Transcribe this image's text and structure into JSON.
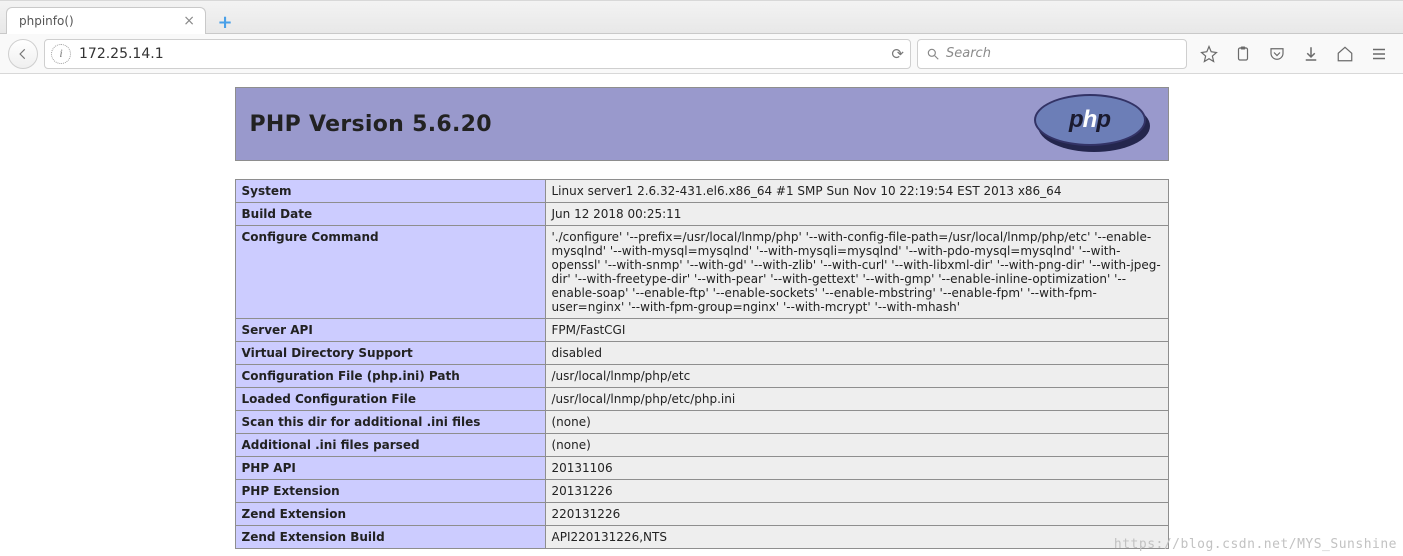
{
  "browser": {
    "tab_title": "phpinfo()",
    "url": "172.25.14.1",
    "search_placeholder": "Search"
  },
  "page": {
    "header_title": "PHP Version 5.6.20",
    "logo_text_a": "p",
    "logo_text_b": "h",
    "logo_text_c": "p",
    "rows": [
      {
        "k": "System",
        "v": "Linux server1 2.6.32-431.el6.x86_64 #1 SMP Sun Nov 10 22:19:54 EST 2013 x86_64"
      },
      {
        "k": "Build Date",
        "v": "Jun 12 2018 00:25:11"
      },
      {
        "k": "Configure Command",
        "v": "'./configure' '--prefix=/usr/local/lnmp/php' '--with-config-file-path=/usr/local/lnmp/php/etc' '--enable-mysqlnd' '--with-mysql=mysqlnd' '--with-mysqli=mysqlnd' '--with-pdo-mysql=mysqlnd' '--with-openssl' '--with-snmp' '--with-gd' '--with-zlib' '--with-curl' '--with-libxml-dir' '--with-png-dir' '--with-jpeg-dir' '--with-freetype-dir' '--with-pear' '--with-gettext' '--with-gmp' '--enable-inline-optimization' '--enable-soap' '--enable-ftp' '--enable-sockets' '--enable-mbstring' '--enable-fpm' '--with-fpm-user=nginx' '--with-fpm-group=nginx' '--with-mcrypt' '--with-mhash'"
      },
      {
        "k": "Server API",
        "v": "FPM/FastCGI"
      },
      {
        "k": "Virtual Directory Support",
        "v": "disabled"
      },
      {
        "k": "Configuration File (php.ini) Path",
        "v": "/usr/local/lnmp/php/etc"
      },
      {
        "k": "Loaded Configuration File",
        "v": "/usr/local/lnmp/php/etc/php.ini"
      },
      {
        "k": "Scan this dir for additional .ini files",
        "v": "(none)"
      },
      {
        "k": "Additional .ini files parsed",
        "v": "(none)"
      },
      {
        "k": "PHP API",
        "v": "20131106"
      },
      {
        "k": "PHP Extension",
        "v": "20131226"
      },
      {
        "k": "Zend Extension",
        "v": "220131226"
      },
      {
        "k": "Zend Extension Build",
        "v": "API220131226,NTS"
      }
    ]
  },
  "watermark": "https://blog.csdn.net/MYS_Sunshine"
}
